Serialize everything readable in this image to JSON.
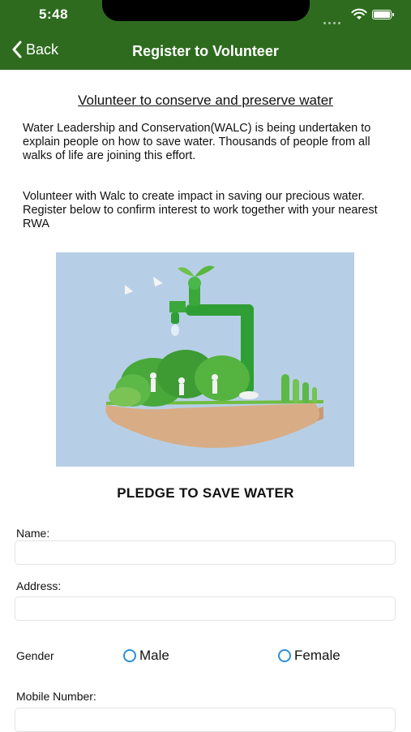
{
  "status_bar": {
    "time": "5:48"
  },
  "nav": {
    "back_label": "Back",
    "title": "Register to Volunteer"
  },
  "content": {
    "heading": "Volunteer to conserve and preserve water",
    "paragraph1": "Water Leadership and Conservation(WALC) is being undertaken to explain people on how to save water. Thousands of people from all walks of life are joining this effort.",
    "paragraph2": "Volunteer with Walc to create impact in saving our precious water. Register below to confirm interest to work together with your nearest RWA",
    "pledge_title": "PLEDGE TO SAVE WATER"
  },
  "form": {
    "name_label": "Name:",
    "name_value": "",
    "address_label": "Address:",
    "address_value": "",
    "gender_label": "Gender",
    "gender_options": [
      "Male",
      "Female"
    ],
    "mobile_label": "Mobile Number:",
    "mobile_value": ""
  },
  "colors": {
    "header_bg": "#2e6b1f",
    "radio_accent": "#2a8fd8"
  }
}
